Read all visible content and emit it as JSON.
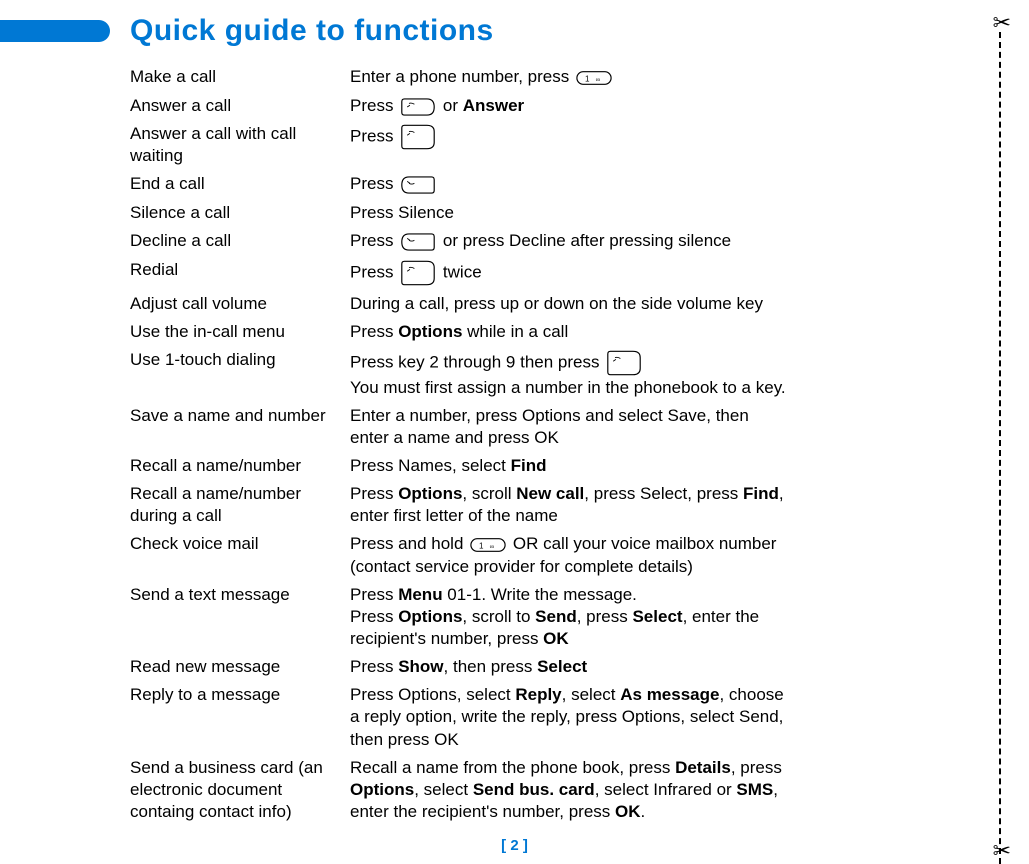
{
  "title": "Quick guide to functions",
  "page_number": "[ 2 ]",
  "rows": [
    {
      "action": "Make a call",
      "desc_pre": "Enter a phone number, press ",
      "icon1": "key1",
      "desc_post": ""
    },
    {
      "action": "Answer a call",
      "desc_pre": "Press ",
      "icon1": "send",
      "desc_post": " or ",
      "bold1": "Answer"
    },
    {
      "action": "Answer a call with call waiting",
      "desc_pre": "Press ",
      "icon1": "send-tall",
      "desc_post": ""
    },
    {
      "action": "End a call",
      "desc_pre": "Press ",
      "icon1": "end",
      "desc_post": ""
    },
    {
      "action": "Silence a call",
      "desc_pre": "Press Silence"
    },
    {
      "action": "Decline a call",
      "desc_pre": "Press ",
      "icon1": "end",
      "desc_post": " or press Decline after pressing silence"
    },
    {
      "action": "Redial",
      "desc_pre": "Press ",
      "icon1": "send-tall",
      "desc_post": " twice"
    },
    {
      "action": "Adjust call volume",
      "desc_pre": "During a call, press up or down on the side volume key"
    },
    {
      "action": "Use the in-call menu",
      "desc_pre": "Press ",
      "bold0": "Options",
      "desc_post": " while in a call"
    },
    {
      "action": "Use 1-touch dialing",
      "desc_pre": "Press key 2 through 9 then press ",
      "icon1": "send-tall",
      "desc_post": "",
      "line2": "You must first assign a number in the phonebook to a key."
    },
    {
      "action": "Save a name and number",
      "desc_pre": "Enter a number, press Options and select Save, then enter a name and press OK"
    },
    {
      "action": "Recall a name/number",
      "desc_pre": "Press Names, select ",
      "bold0": "Find"
    },
    {
      "action": "Recall a name/number during a call",
      "desc_pre": "Press ",
      "bold0": "Options",
      "mid1": ", scroll ",
      "bold1": "New call",
      "mid2": ", press Select, press ",
      "bold2": "Find",
      "desc_post": ", enter first letter of the name"
    },
    {
      "action": "Check voice mail",
      "desc_pre": "Press and hold ",
      "icon1": "key1",
      "desc_post": " OR call your voice mailbox number (contact service provider for complete details)"
    },
    {
      "action": "Send a text message",
      "desc_pre": "Press ",
      "bold0": "Menu",
      "mid1": " 01-1. Write the message.",
      "line2pre": "Press ",
      "line2b0": "Options",
      "line2m1": ", scroll to ",
      "line2b1": "Send",
      "line2m2": ", press ",
      "line2b2": "Select",
      "line2m3": ", enter the recipient's number, press ",
      "line2b3": "OK"
    },
    {
      "action": "Read new message",
      "desc_pre": "Press ",
      "bold0": "Show",
      "mid1": ", then press ",
      "bold1": "Select"
    },
    {
      "action": "Reply to a message",
      "desc_pre": "Press Options, select ",
      "bold0": "Reply",
      "mid1": ", select ",
      "bold1": "As message",
      "desc_post": ", choose a reply option, write the reply, press Options, select Send, then press OK"
    },
    {
      "action": "Send a business card (an electronic document containg contact info)",
      "desc_pre": "Recall a name from the phone book, press ",
      "bold0": "Details",
      "mid1": ", press ",
      "bold1": "Options",
      "mid2": ", select ",
      "bold2": "Send bus. card",
      "mid3": ", select Infrared or ",
      "bold3": "SMS",
      "mid4": ", enter the recipient's number, press ",
      "bold4": "OK",
      "desc_post": "."
    }
  ]
}
